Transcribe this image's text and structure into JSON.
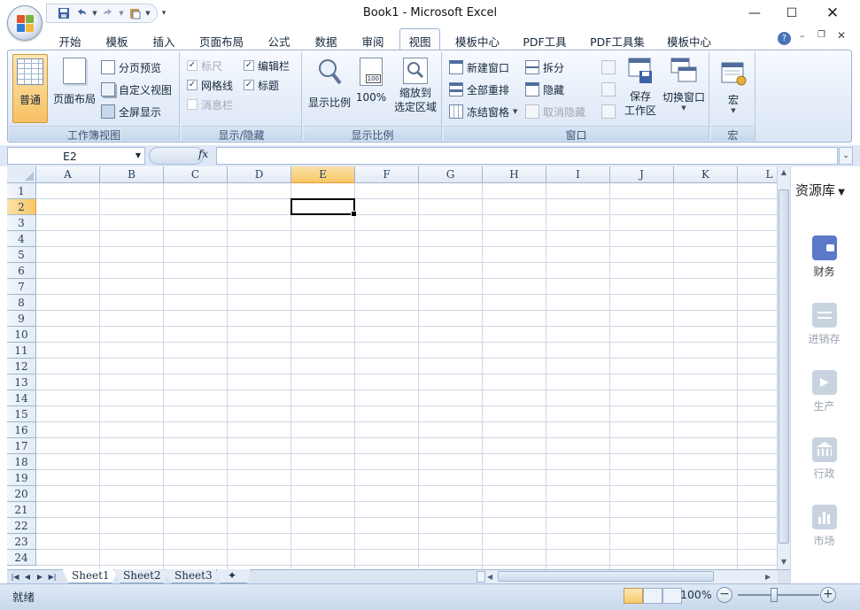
{
  "window": {
    "title": "Book1 - Microsoft Excel"
  },
  "tabs": [
    {
      "label": "开始",
      "active": false
    },
    {
      "label": "模板",
      "active": false
    },
    {
      "label": "插入",
      "active": false
    },
    {
      "label": "页面布局",
      "active": false
    },
    {
      "label": "公式",
      "active": false
    },
    {
      "label": "数据",
      "active": false
    },
    {
      "label": "审阅",
      "active": false
    },
    {
      "label": "视图",
      "active": true
    },
    {
      "label": "模板中心",
      "active": false
    },
    {
      "label": "PDF工具",
      "active": false
    },
    {
      "label": "PDF工具集",
      "active": false
    },
    {
      "label": "模板中心",
      "active": false
    }
  ],
  "ribbon": {
    "workbook_views": {
      "label": "工作簿视图",
      "normal": "普通",
      "page_layout": "页面布局",
      "page_break_preview": "分页预览",
      "custom_views": "自定义视图",
      "full_screen": "全屏显示"
    },
    "show_hide": {
      "label": "显示/隐藏",
      "ruler": "标尺",
      "formula_bar": "编辑栏",
      "gridlines": "网格线",
      "headings": "标题",
      "message_bar": "消息栏"
    },
    "zoom": {
      "label": "显示比例",
      "zoom": "显示比例",
      "hundred": "100%",
      "zoom_to_selection_l1": "缩放到",
      "zoom_to_selection_l2": "选定区域"
    },
    "window": {
      "label": "窗口",
      "new_window": "新建窗口",
      "arrange_all": "全部重排",
      "freeze_panes": "冻结窗格",
      "split": "拆分",
      "hide": "隐藏",
      "unhide": "取消隐藏",
      "save_workspace_l1": "保存",
      "save_workspace_l2": "工作区",
      "switch_windows": "切换窗口"
    },
    "macros": {
      "label": "宏",
      "macros": "宏"
    }
  },
  "formula_bar": {
    "name_box": "E2",
    "fx": "fx",
    "formula": ""
  },
  "grid": {
    "columns": [
      "A",
      "B",
      "C",
      "D",
      "E",
      "F",
      "G",
      "H",
      "I",
      "J",
      "K",
      "L"
    ],
    "rows": [
      "1",
      "2",
      "3",
      "4",
      "5",
      "6",
      "7",
      "8",
      "9",
      "10",
      "11",
      "12",
      "13",
      "14",
      "15",
      "16",
      "17",
      "18",
      "19",
      "20",
      "21",
      "22",
      "23",
      "24"
    ],
    "selected_column": "E",
    "selected_row": "2"
  },
  "resource_panel": {
    "title": "资源库",
    "items": [
      {
        "label": "财务",
        "icon": "wallet-icon",
        "active": true
      },
      {
        "label": "进销存",
        "icon": "exchange-icon",
        "active": false
      },
      {
        "label": "生产",
        "icon": "arrow-box-icon",
        "active": false
      },
      {
        "label": "行政",
        "icon": "building-icon",
        "active": false
      },
      {
        "label": "市场",
        "icon": "bar-chart-icon",
        "active": false
      }
    ]
  },
  "sheets": [
    {
      "label": "Sheet1",
      "active": true
    },
    {
      "label": "Sheet2",
      "active": false
    },
    {
      "label": "Sheet3",
      "active": false
    }
  ],
  "status": {
    "ready": "就绪",
    "zoom": "100%"
  },
  "colors": {
    "accent": "#f7c764",
    "ribbon": "#dbe6f4",
    "gridline": "#d0d7e5",
    "panel_icon": "#5b78c9"
  }
}
